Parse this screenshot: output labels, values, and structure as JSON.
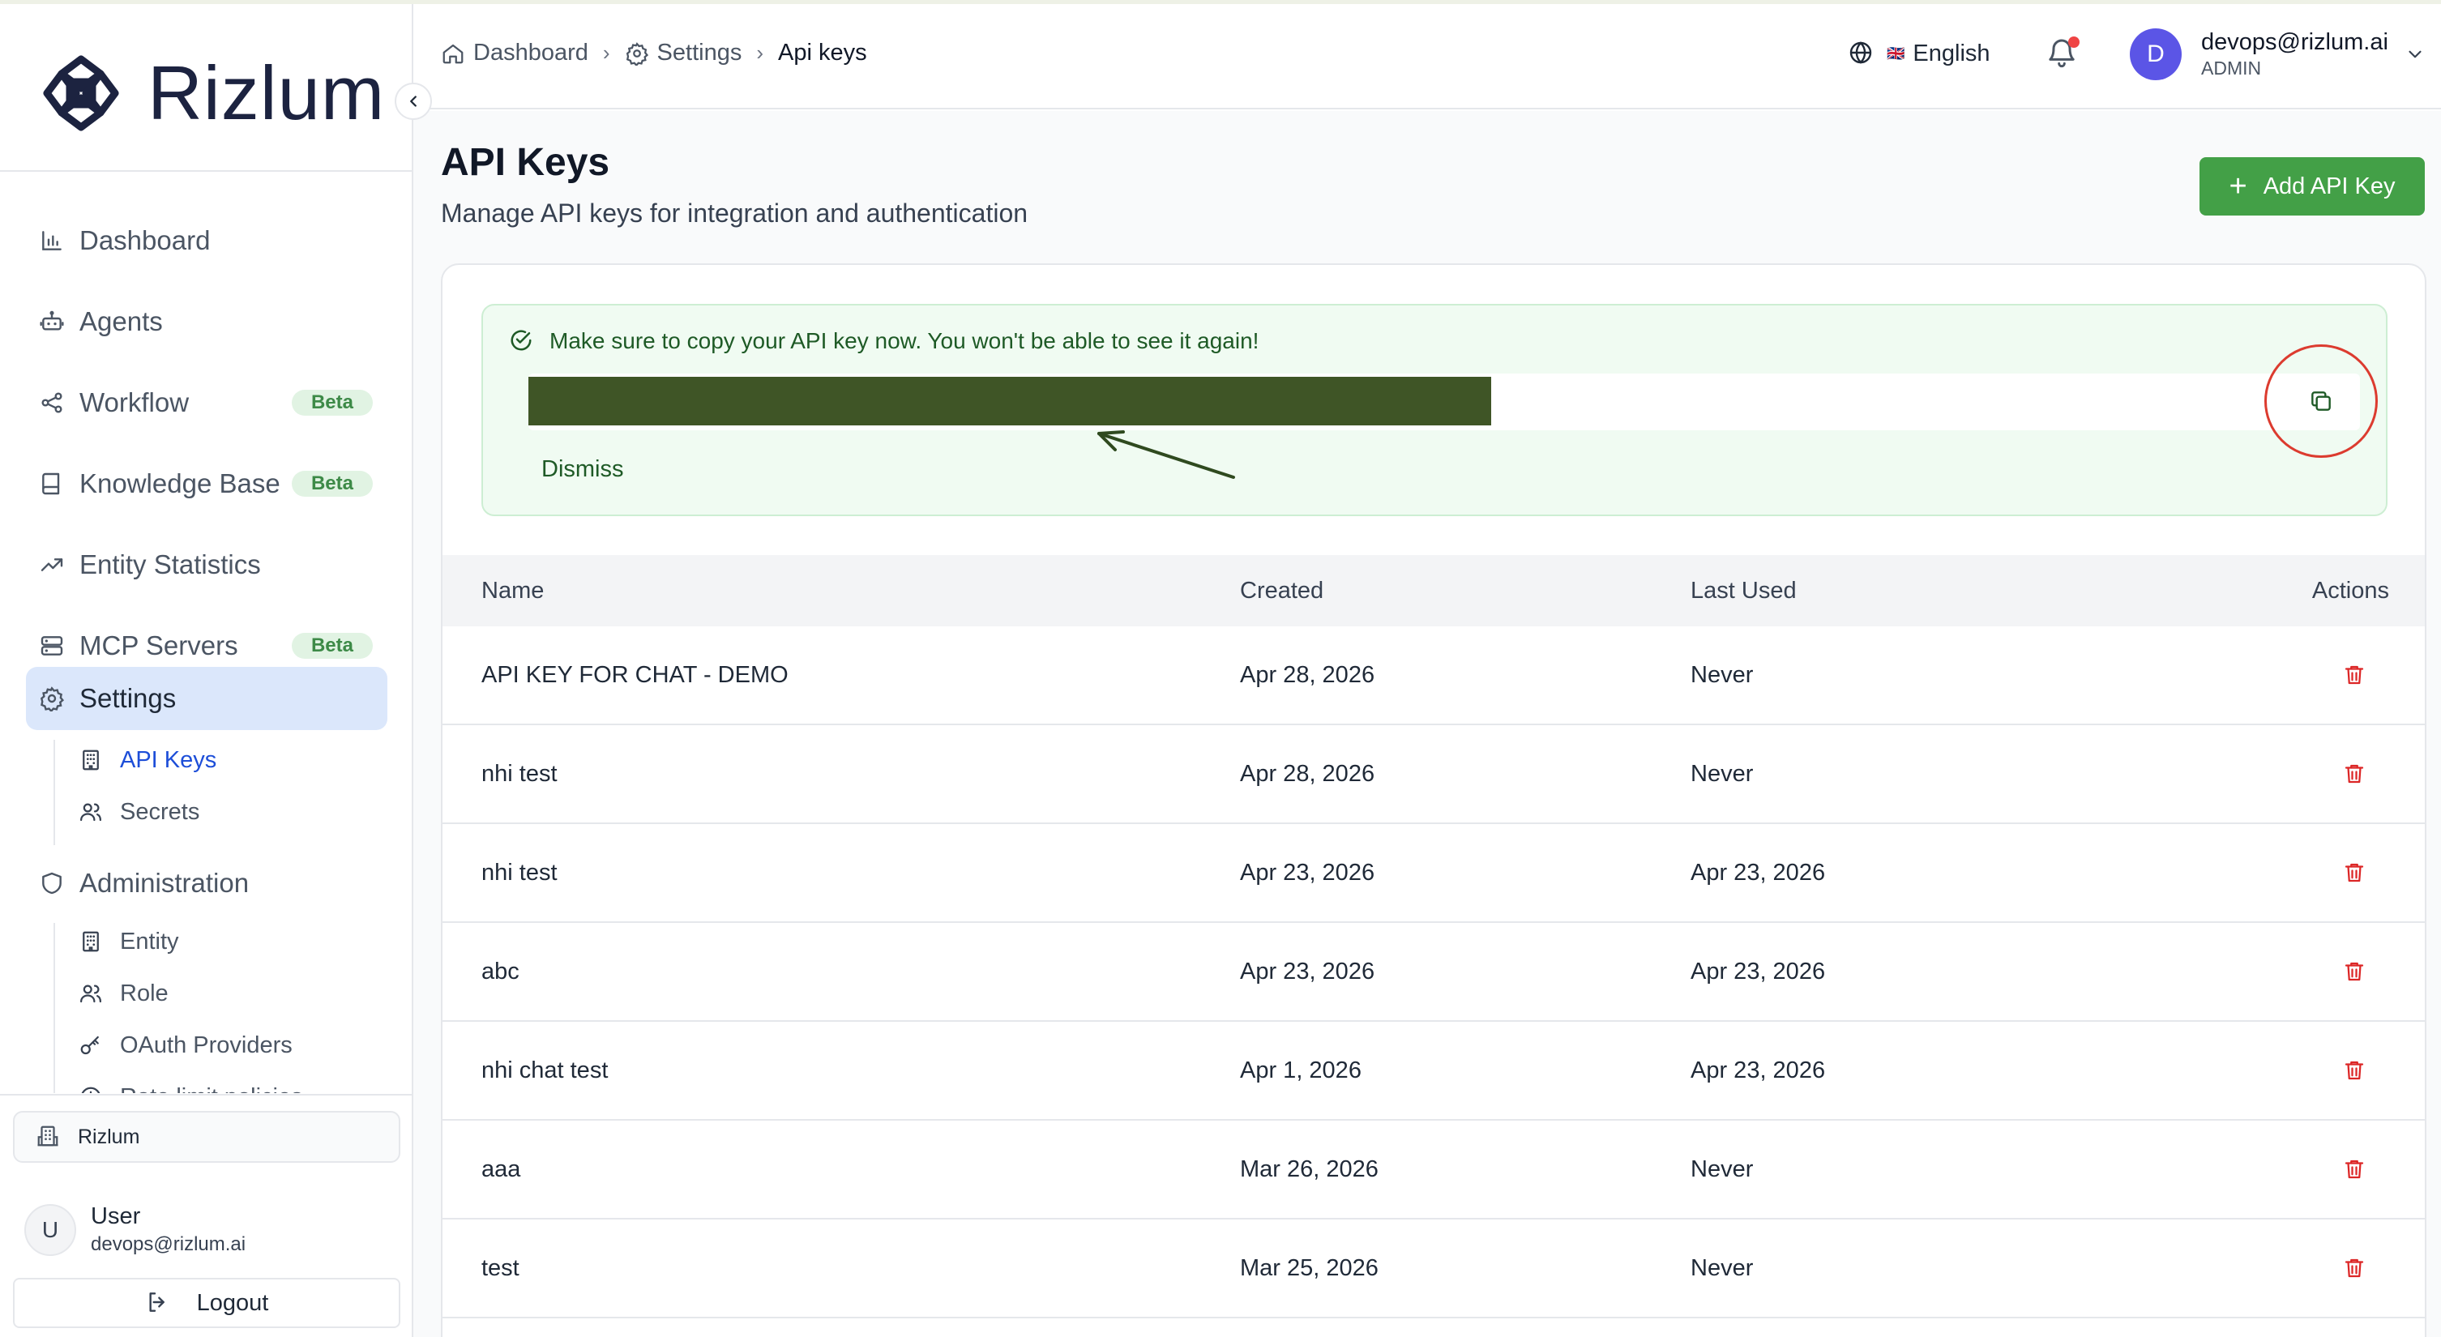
{
  "brand": {
    "name": "Rizlum"
  },
  "sidebar": {
    "items": [
      {
        "label": "Dashboard",
        "icon": "bar-chart-icon"
      },
      {
        "label": "Agents",
        "icon": "bot-icon"
      },
      {
        "label": "Workflow",
        "icon": "share-nodes-icon",
        "badge": "Beta"
      },
      {
        "label": "Knowledge Base",
        "icon": "book-icon",
        "badge": "Beta"
      },
      {
        "label": "Entity Statistics",
        "icon": "trend-up-icon"
      },
      {
        "label": "MCP Servers",
        "icon": "server-icon",
        "badge": "Beta"
      },
      {
        "label": "Settings",
        "icon": "gear-icon",
        "active": true
      }
    ],
    "settings_sub": [
      {
        "label": "API Keys",
        "icon": "building-icon",
        "active": true
      },
      {
        "label": "Secrets",
        "icon": "users-icon"
      }
    ],
    "administration": {
      "label": "Administration",
      "icon": "shield-icon",
      "sub": [
        {
          "label": "Entity",
          "icon": "building-icon"
        },
        {
          "label": "Role",
          "icon": "users-icon"
        },
        {
          "label": "OAuth Providers",
          "icon": "key-icon"
        },
        {
          "label": "Rate limit policies",
          "icon": "clock-icon"
        }
      ]
    },
    "org": "Rizlum",
    "user": {
      "initial": "U",
      "name": "User",
      "email": "devops@rizlum.ai"
    },
    "logout": "Logout"
  },
  "header": {
    "breadcrumb": [
      {
        "label": "Dashboard",
        "icon": "home-icon"
      },
      {
        "label": "Settings",
        "icon": "gear-icon"
      },
      {
        "label": "Api keys"
      }
    ],
    "language": {
      "flag": "🇬🇧",
      "label": "English"
    },
    "profile": {
      "initial": "D",
      "email": "devops@rizlum.ai",
      "role": "ADMIN"
    }
  },
  "page": {
    "title": "API Keys",
    "subtitle": "Manage API keys for integration and authentication",
    "add_button": "Add API Key"
  },
  "alert": {
    "message": "Make sure to copy your API key now. You won't be able to see it again!",
    "dismiss": "Dismiss"
  },
  "table": {
    "headers": {
      "name": "Name",
      "created": "Created",
      "last_used": "Last Used",
      "actions": "Actions"
    },
    "rows": [
      {
        "name": "API KEY FOR CHAT - DEMO",
        "created": "Apr 28, 2026",
        "last_used": "Never"
      },
      {
        "name": "nhi test",
        "created": "Apr 28, 2026",
        "last_used": "Never"
      },
      {
        "name": "nhi test",
        "created": "Apr 23, 2026",
        "last_used": "Apr 23, 2026"
      },
      {
        "name": "abc",
        "created": "Apr 23, 2026",
        "last_used": "Apr 23, 2026"
      },
      {
        "name": "nhi chat test",
        "created": "Apr 1, 2026",
        "last_used": "Apr 23, 2026"
      },
      {
        "name": "aaa",
        "created": "Mar 26, 2026",
        "last_used": "Never"
      },
      {
        "name": "test",
        "created": "Mar 25, 2026",
        "last_used": "Never"
      }
    ]
  },
  "colors": {
    "primary_green": "#43a047",
    "active_nav_bg": "#dbe7fb",
    "alert_bg": "#f0fbf2",
    "masked_key": "#3f5526",
    "danger": "#dc2626",
    "annotation_circle": "#dc3b2f",
    "avatar": "#5b55e6"
  }
}
